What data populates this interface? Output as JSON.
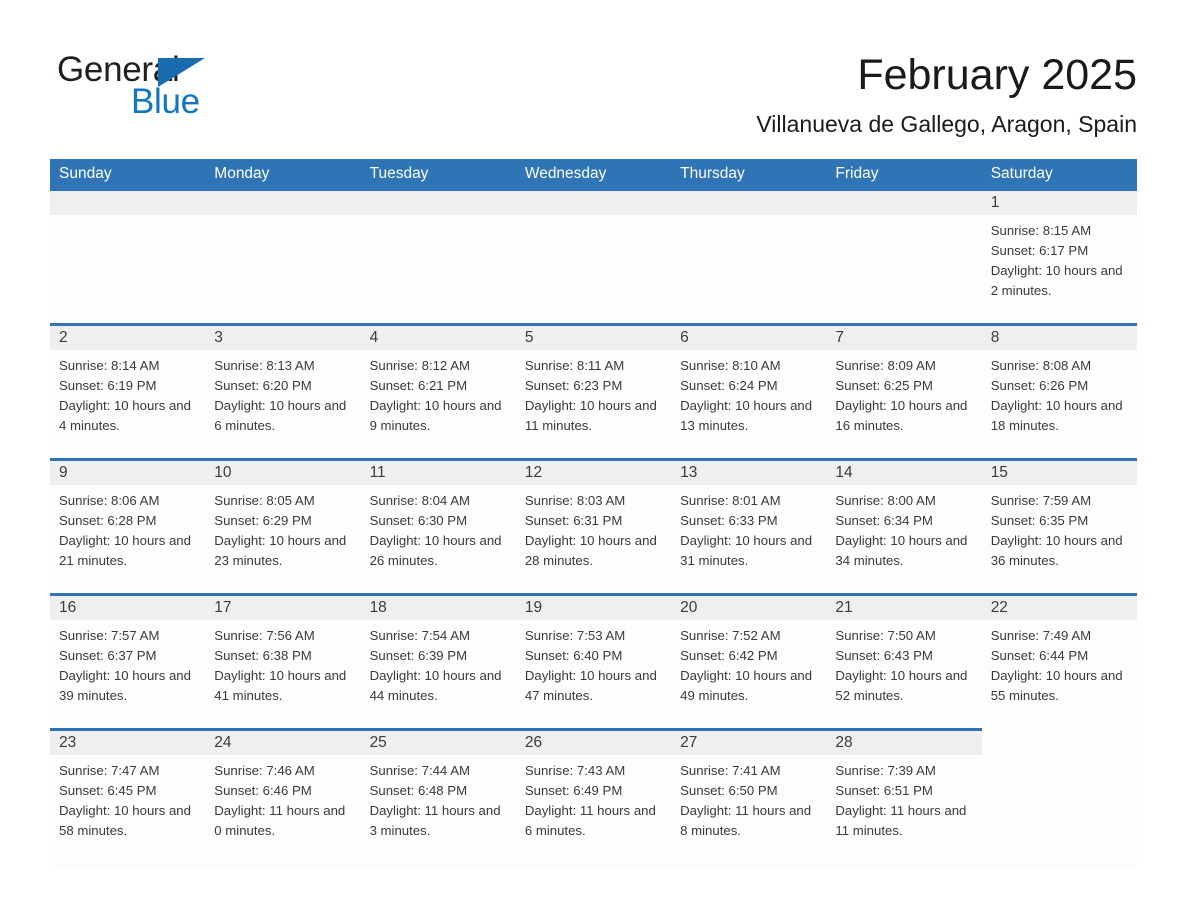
{
  "brand": {
    "name_part1": "General",
    "name_part2": "Blue",
    "accent_color": "#1a6cb0",
    "blue_text_color": "#1277c0"
  },
  "header": {
    "month_title": "February 2025",
    "location": "Villanueva de Gallego, Aragon, Spain"
  },
  "calendar": {
    "header_bg": "#2f74b5",
    "daynum_strip_bg": "#efefef",
    "weekdays": [
      "Sunday",
      "Monday",
      "Tuesday",
      "Wednesday",
      "Thursday",
      "Friday",
      "Saturday"
    ],
    "weeks": [
      [
        {
          "type": "empty"
        },
        {
          "type": "empty"
        },
        {
          "type": "empty"
        },
        {
          "type": "empty"
        },
        {
          "type": "empty"
        },
        {
          "type": "empty"
        },
        {
          "type": "day",
          "day": "1",
          "sunrise": "Sunrise: 8:15 AM",
          "sunset": "Sunset: 6:17 PM",
          "daylight": "Daylight: 10 hours and 2 minutes."
        }
      ],
      [
        {
          "type": "day",
          "day": "2",
          "sunrise": "Sunrise: 8:14 AM",
          "sunset": "Sunset: 6:19 PM",
          "daylight": "Daylight: 10 hours and 4 minutes."
        },
        {
          "type": "day",
          "day": "3",
          "sunrise": "Sunrise: 8:13 AM",
          "sunset": "Sunset: 6:20 PM",
          "daylight": "Daylight: 10 hours and 6 minutes."
        },
        {
          "type": "day",
          "day": "4",
          "sunrise": "Sunrise: 8:12 AM",
          "sunset": "Sunset: 6:21 PM",
          "daylight": "Daylight: 10 hours and 9 minutes."
        },
        {
          "type": "day",
          "day": "5",
          "sunrise": "Sunrise: 8:11 AM",
          "sunset": "Sunset: 6:23 PM",
          "daylight": "Daylight: 10 hours and 11 minutes."
        },
        {
          "type": "day",
          "day": "6",
          "sunrise": "Sunrise: 8:10 AM",
          "sunset": "Sunset: 6:24 PM",
          "daylight": "Daylight: 10 hours and 13 minutes."
        },
        {
          "type": "day",
          "day": "7",
          "sunrise": "Sunrise: 8:09 AM",
          "sunset": "Sunset: 6:25 PM",
          "daylight": "Daylight: 10 hours and 16 minutes."
        },
        {
          "type": "day",
          "day": "8",
          "sunrise": "Sunrise: 8:08 AM",
          "sunset": "Sunset: 6:26 PM",
          "daylight": "Daylight: 10 hours and 18 minutes."
        }
      ],
      [
        {
          "type": "day",
          "day": "9",
          "sunrise": "Sunrise: 8:06 AM",
          "sunset": "Sunset: 6:28 PM",
          "daylight": "Daylight: 10 hours and 21 minutes."
        },
        {
          "type": "day",
          "day": "10",
          "sunrise": "Sunrise: 8:05 AM",
          "sunset": "Sunset: 6:29 PM",
          "daylight": "Daylight: 10 hours and 23 minutes."
        },
        {
          "type": "day",
          "day": "11",
          "sunrise": "Sunrise: 8:04 AM",
          "sunset": "Sunset: 6:30 PM",
          "daylight": "Daylight: 10 hours and 26 minutes."
        },
        {
          "type": "day",
          "day": "12",
          "sunrise": "Sunrise: 8:03 AM",
          "sunset": "Sunset: 6:31 PM",
          "daylight": "Daylight: 10 hours and 28 minutes."
        },
        {
          "type": "day",
          "day": "13",
          "sunrise": "Sunrise: 8:01 AM",
          "sunset": "Sunset: 6:33 PM",
          "daylight": "Daylight: 10 hours and 31 minutes."
        },
        {
          "type": "day",
          "day": "14",
          "sunrise": "Sunrise: 8:00 AM",
          "sunset": "Sunset: 6:34 PM",
          "daylight": "Daylight: 10 hours and 34 minutes."
        },
        {
          "type": "day",
          "day": "15",
          "sunrise": "Sunrise: 7:59 AM",
          "sunset": "Sunset: 6:35 PM",
          "daylight": "Daylight: 10 hours and 36 minutes."
        }
      ],
      [
        {
          "type": "day",
          "day": "16",
          "sunrise": "Sunrise: 7:57 AM",
          "sunset": "Sunset: 6:37 PM",
          "daylight": "Daylight: 10 hours and 39 minutes."
        },
        {
          "type": "day",
          "day": "17",
          "sunrise": "Sunrise: 7:56 AM",
          "sunset": "Sunset: 6:38 PM",
          "daylight": "Daylight: 10 hours and 41 minutes."
        },
        {
          "type": "day",
          "day": "18",
          "sunrise": "Sunrise: 7:54 AM",
          "sunset": "Sunset: 6:39 PM",
          "daylight": "Daylight: 10 hours and 44 minutes."
        },
        {
          "type": "day",
          "day": "19",
          "sunrise": "Sunrise: 7:53 AM",
          "sunset": "Sunset: 6:40 PM",
          "daylight": "Daylight: 10 hours and 47 minutes."
        },
        {
          "type": "day",
          "day": "20",
          "sunrise": "Sunrise: 7:52 AM",
          "sunset": "Sunset: 6:42 PM",
          "daylight": "Daylight: 10 hours and 49 minutes."
        },
        {
          "type": "day",
          "day": "21",
          "sunrise": "Sunrise: 7:50 AM",
          "sunset": "Sunset: 6:43 PM",
          "daylight": "Daylight: 10 hours and 52 minutes."
        },
        {
          "type": "day",
          "day": "22",
          "sunrise": "Sunrise: 7:49 AM",
          "sunset": "Sunset: 6:44 PM",
          "daylight": "Daylight: 10 hours and 55 minutes."
        }
      ],
      [
        {
          "type": "day",
          "day": "23",
          "sunrise": "Sunrise: 7:47 AM",
          "sunset": "Sunset: 6:45 PM",
          "daylight": "Daylight: 10 hours and 58 minutes."
        },
        {
          "type": "day",
          "day": "24",
          "sunrise": "Sunrise: 7:46 AM",
          "sunset": "Sunset: 6:46 PM",
          "daylight": "Daylight: 11 hours and 0 minutes."
        },
        {
          "type": "day",
          "day": "25",
          "sunrise": "Sunrise: 7:44 AM",
          "sunset": "Sunset: 6:48 PM",
          "daylight": "Daylight: 11 hours and 3 minutes."
        },
        {
          "type": "day",
          "day": "26",
          "sunrise": "Sunrise: 7:43 AM",
          "sunset": "Sunset: 6:49 PM",
          "daylight": "Daylight: 11 hours and 6 minutes."
        },
        {
          "type": "day",
          "day": "27",
          "sunrise": "Sunrise: 7:41 AM",
          "sunset": "Sunset: 6:50 PM",
          "daylight": "Daylight: 11 hours and 8 minutes."
        },
        {
          "type": "day",
          "day": "28",
          "sunrise": "Sunrise: 7:39 AM",
          "sunset": "Sunset: 6:51 PM",
          "daylight": "Daylight: 11 hours and 11 minutes."
        },
        {
          "type": "blank"
        }
      ]
    ]
  }
}
